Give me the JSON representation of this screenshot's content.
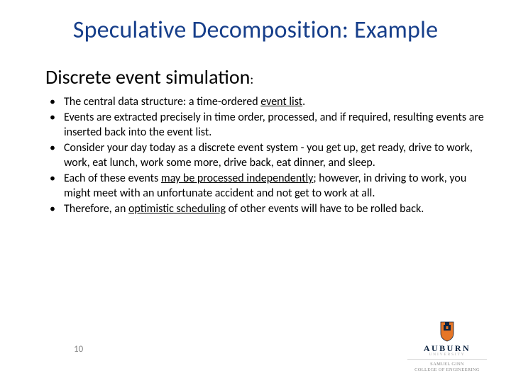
{
  "title": "Speculative Decomposition: Example",
  "subtitle": "Discrete event simulation",
  "bullets": [
    {
      "pre": "The central data structure: a time-ordered ",
      "u": "event list",
      "post": "."
    },
    {
      "pre": "Events are extracted precisely in time order, processed, and if required, resulting events are inserted back into the event list.",
      "u": "",
      "post": ""
    },
    {
      "pre": "Consider your day today as a discrete event system - you get up, get ready, drive to work, work, eat lunch, work some more, drive back, eat dinner, and sleep.",
      "u": "",
      "post": ""
    },
    {
      "pre": "Each of these events ",
      "u": "may be processed independently",
      "post": "; however, in driving to work, you might meet with an unfortunate accident and not get to work at all."
    },
    {
      "pre": "Therefore, an ",
      "u": "optimistic scheduling",
      "post": " of other events will have to be rolled back."
    }
  ],
  "page_number": "10",
  "logo": {
    "name": "AUBURN",
    "sub": "UNIVERSITY",
    "college_l1": "SAMUEL GINN",
    "college_l2": "COLLEGE OF ENGINEERING"
  }
}
